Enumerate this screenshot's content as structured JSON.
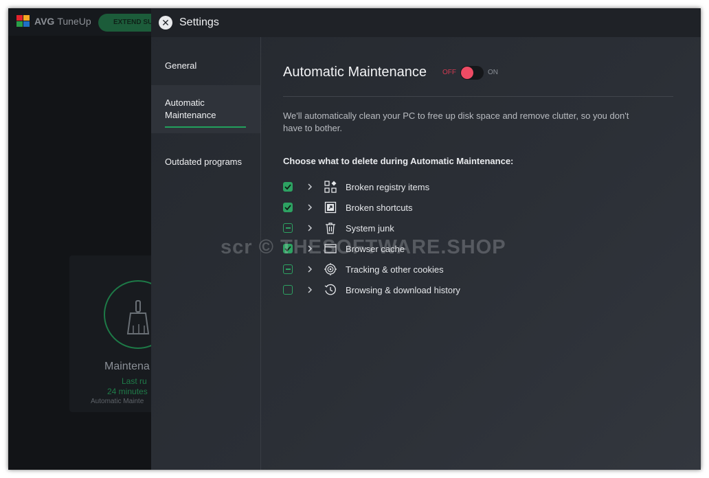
{
  "background_app": {
    "brand": "AVG",
    "product": "TuneUp",
    "extend_button": "EXTEND SU",
    "card": {
      "title": "Maintena",
      "line1": "Last ru",
      "line2": "24 minutes",
      "line3": "Automatic Mainte"
    }
  },
  "settings": {
    "title": "Settings",
    "sidebar": [
      {
        "label": "General"
      },
      {
        "label": "Automatic Maintenance",
        "line1": "Automatic",
        "line2": "Maintenance",
        "active": true
      },
      {
        "label": "Outdated programs"
      }
    ],
    "main": {
      "heading": "Automatic Maintenance",
      "toggle": {
        "off_label": "OFF",
        "on_label": "ON",
        "state": "off"
      },
      "description": "We'll automatically clean your PC to free up disk space and remove clutter, so you don't have to bother.",
      "choose_label": "Choose what to delete during Automatic Maintenance:",
      "items": [
        {
          "label": "Broken registry items",
          "state": "checked",
          "icon": "registry-icon"
        },
        {
          "label": "Broken shortcuts",
          "state": "checked",
          "icon": "shortcut-icon"
        },
        {
          "label": "System junk",
          "state": "partial",
          "icon": "trash-icon"
        },
        {
          "label": "Browser cache",
          "state": "checked",
          "icon": "browser-window-icon"
        },
        {
          "label": "Tracking & other cookies",
          "state": "partial",
          "icon": "tracking-target-icon"
        },
        {
          "label": "Browsing & download history",
          "state": "unchecked",
          "icon": "history-clock-icon"
        }
      ]
    }
  },
  "watermark": "scr © THESOFTWARE.SHOP",
  "colors": {
    "accent_green": "#2da262",
    "toggle_off_red": "#ee4b64",
    "panel_bg": "#2b2f36"
  }
}
